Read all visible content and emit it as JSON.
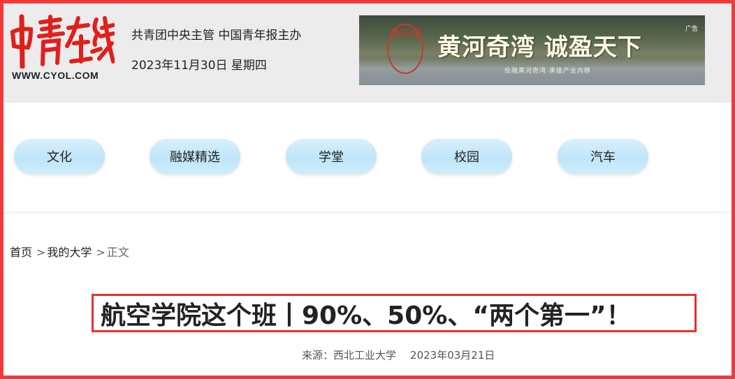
{
  "header": {
    "logo_url": "WWW.CYOL.COM",
    "org_text": "共青团中央主管 中国青年报主办",
    "date_text": "2023年11月30日 星期四"
  },
  "ad": {
    "seal_text": "黄石楼",
    "slogan": "黄河奇湾 诚盈天下",
    "subtitle": "投融黄河奇湾 承接产业内移",
    "tag": "广告"
  },
  "nav": {
    "items": [
      {
        "label": "文化"
      },
      {
        "label": "融媒精选"
      },
      {
        "label": "学堂"
      },
      {
        "label": "校园"
      },
      {
        "label": "汽车"
      }
    ]
  },
  "breadcrumb": {
    "home": "首页",
    "separator": ">",
    "section": "我的大学",
    "current": "正文"
  },
  "article": {
    "title": "航空学院这个班丨90%、50%、“两个第一”！",
    "source_label": "来源：",
    "source": "西北工业大学",
    "date": "2023年03月21日"
  },
  "colors": {
    "frame": "#f03a3a",
    "logo_red": "#e0201c",
    "nav_pill": "#c6e9fb",
    "title_border": "#e5322d"
  }
}
